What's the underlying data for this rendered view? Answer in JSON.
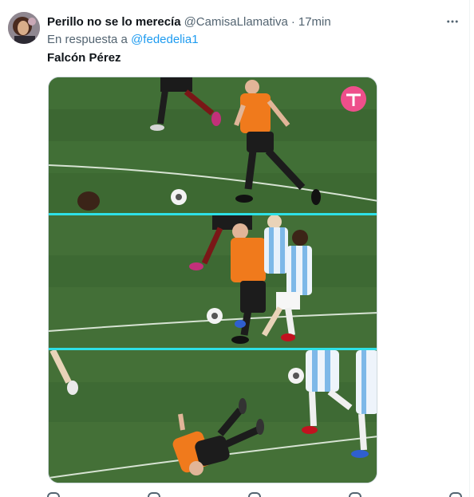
{
  "tweet": {
    "author_name": "Perillo no se lo merecía",
    "handle": "@CamisaLlamativa",
    "separator": "·",
    "time": "17min",
    "reply_prefix": "En respuesta a",
    "reply_mention": "@fededelia1",
    "text": "Falcón Pérez"
  },
  "media": {
    "frames": [
      "frame-1-referee-running",
      "frame-2-collision",
      "frame-3-referee-falling"
    ],
    "separator_color": "#2ee0e6",
    "broadcaster_logo": "tv-pink-logo"
  },
  "colors": {
    "pitch": "#3f6a34",
    "accent_link": "#1d9bf0",
    "referee_shirt": "#f07a1c"
  }
}
